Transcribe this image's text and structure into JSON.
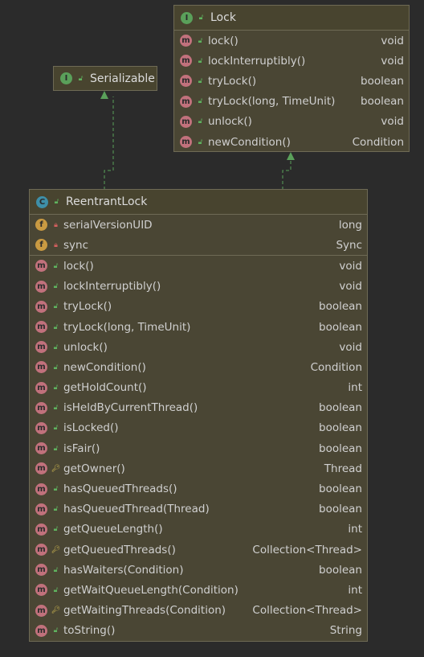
{
  "serializable": {
    "name": "Serializable",
    "kind": "I"
  },
  "lock": {
    "name": "Lock",
    "kind": "I",
    "methods": [
      {
        "label": "lock()",
        "type": "void"
      },
      {
        "label": "lockInterruptibly()",
        "type": "void"
      },
      {
        "label": "tryLock()",
        "type": "boolean"
      },
      {
        "label": "tryLock(long, TimeUnit)",
        "type": "boolean"
      },
      {
        "label": "unlock()",
        "type": "void"
      },
      {
        "label": "newCondition()",
        "type": "Condition"
      }
    ]
  },
  "reentrant": {
    "name": "ReentrantLock",
    "kind": "C",
    "fields": [
      {
        "label": "serialVersionUID",
        "type": "long"
      },
      {
        "label": "sync",
        "type": "Sync"
      }
    ],
    "methods": [
      {
        "label": "lock()",
        "type": "void",
        "vis": "public"
      },
      {
        "label": "lockInterruptibly()",
        "type": "void",
        "vis": "public"
      },
      {
        "label": "tryLock()",
        "type": "boolean",
        "vis": "public"
      },
      {
        "label": "tryLock(long, TimeUnit)",
        "type": "boolean",
        "vis": "public"
      },
      {
        "label": "unlock()",
        "type": "void",
        "vis": "public"
      },
      {
        "label": "newCondition()",
        "type": "Condition",
        "vis": "public"
      },
      {
        "label": "getHoldCount()",
        "type": "int",
        "vis": "public"
      },
      {
        "label": "isHeldByCurrentThread()",
        "type": "boolean",
        "vis": "public"
      },
      {
        "label": "isLocked()",
        "type": "boolean",
        "vis": "public"
      },
      {
        "label": "isFair()",
        "type": "boolean",
        "vis": "public"
      },
      {
        "label": "getOwner()",
        "type": "Thread",
        "vis": "protected"
      },
      {
        "label": "hasQueuedThreads()",
        "type": "boolean",
        "vis": "public"
      },
      {
        "label": "hasQueuedThread(Thread)",
        "type": "boolean",
        "vis": "public"
      },
      {
        "label": "getQueueLength()",
        "type": "int",
        "vis": "public"
      },
      {
        "label": "getQueuedThreads()",
        "type": "Collection<Thread>",
        "vis": "protected"
      },
      {
        "label": "hasWaiters(Condition)",
        "type": "boolean",
        "vis": "public"
      },
      {
        "label": "getWaitQueueLength(Condition)",
        "type": "int",
        "vis": "public"
      },
      {
        "label": "getWaitingThreads(Condition)",
        "type": "Collection<Thread>",
        "vis": "protected"
      },
      {
        "label": "toString()",
        "type": "String",
        "vis": "public"
      }
    ]
  },
  "colors": {
    "box": "#4a4634",
    "border": "#6e6a55",
    "arrow": "#5aa05a"
  }
}
